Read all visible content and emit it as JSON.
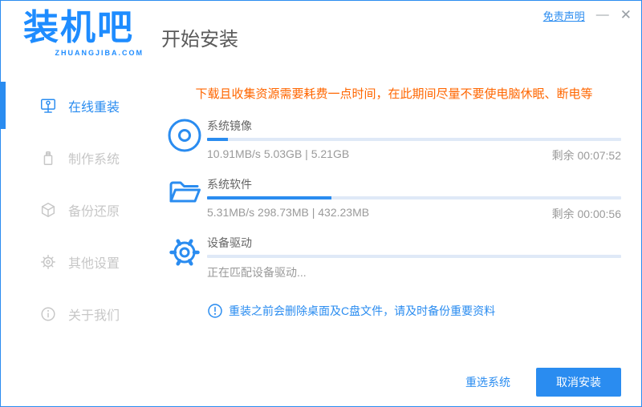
{
  "colors": {
    "primary_blue": "#2a8cf0",
    "logo_blue": "#1e8cff",
    "warning_orange": "#ff6600",
    "stats_gray": "#9a9a9a",
    "inactive_gray": "#c7c7c7",
    "progress_track": "#dfe9f7"
  },
  "titlebar": {
    "logo_text": "装机吧",
    "logo_sub": "ZHUANGJIBA.COM",
    "page_title": "开始安装",
    "disclaimer_link": "免责声明",
    "minimize_glyph": "—",
    "close_glyph": "✕"
  },
  "sidebar": {
    "items": [
      {
        "label": "在线重装",
        "icon": "computer-icon",
        "active": true
      },
      {
        "label": "制作系统",
        "icon": "usb-icon",
        "active": false
      },
      {
        "label": "备份还原",
        "icon": "backup-icon",
        "active": false
      },
      {
        "label": "其他设置",
        "icon": "settings-icon",
        "active": false
      },
      {
        "label": "关于我们",
        "icon": "info-icon",
        "active": false
      }
    ]
  },
  "main": {
    "warning": "下载且收集资源需要耗费一点时间，在此期间尽量不要使电脑休眠、断电等",
    "tasks": [
      {
        "name": "系统镜像",
        "icon": "disc-icon",
        "progress_percent": 5,
        "stats": "10.91MB/s 5.03GB | 5.21GB",
        "remaining": "剩余 00:07:52"
      },
      {
        "name": "系统软件",
        "icon": "folder-icon",
        "progress_percent": 30,
        "stats": "5.31MB/s 298.73MB | 432.23MB",
        "remaining": "剩余 00:00:56"
      },
      {
        "name": "设备驱动",
        "icon": "gear-icon",
        "progress_percent": 0,
        "stats": "正在匹配设备驱动...",
        "remaining": ""
      }
    ],
    "tip": "重装之前会删除桌面及C盘文件，请及时备份重要资料"
  },
  "footer": {
    "reselect_label": "重选系统",
    "cancel_label": "取消安装"
  }
}
